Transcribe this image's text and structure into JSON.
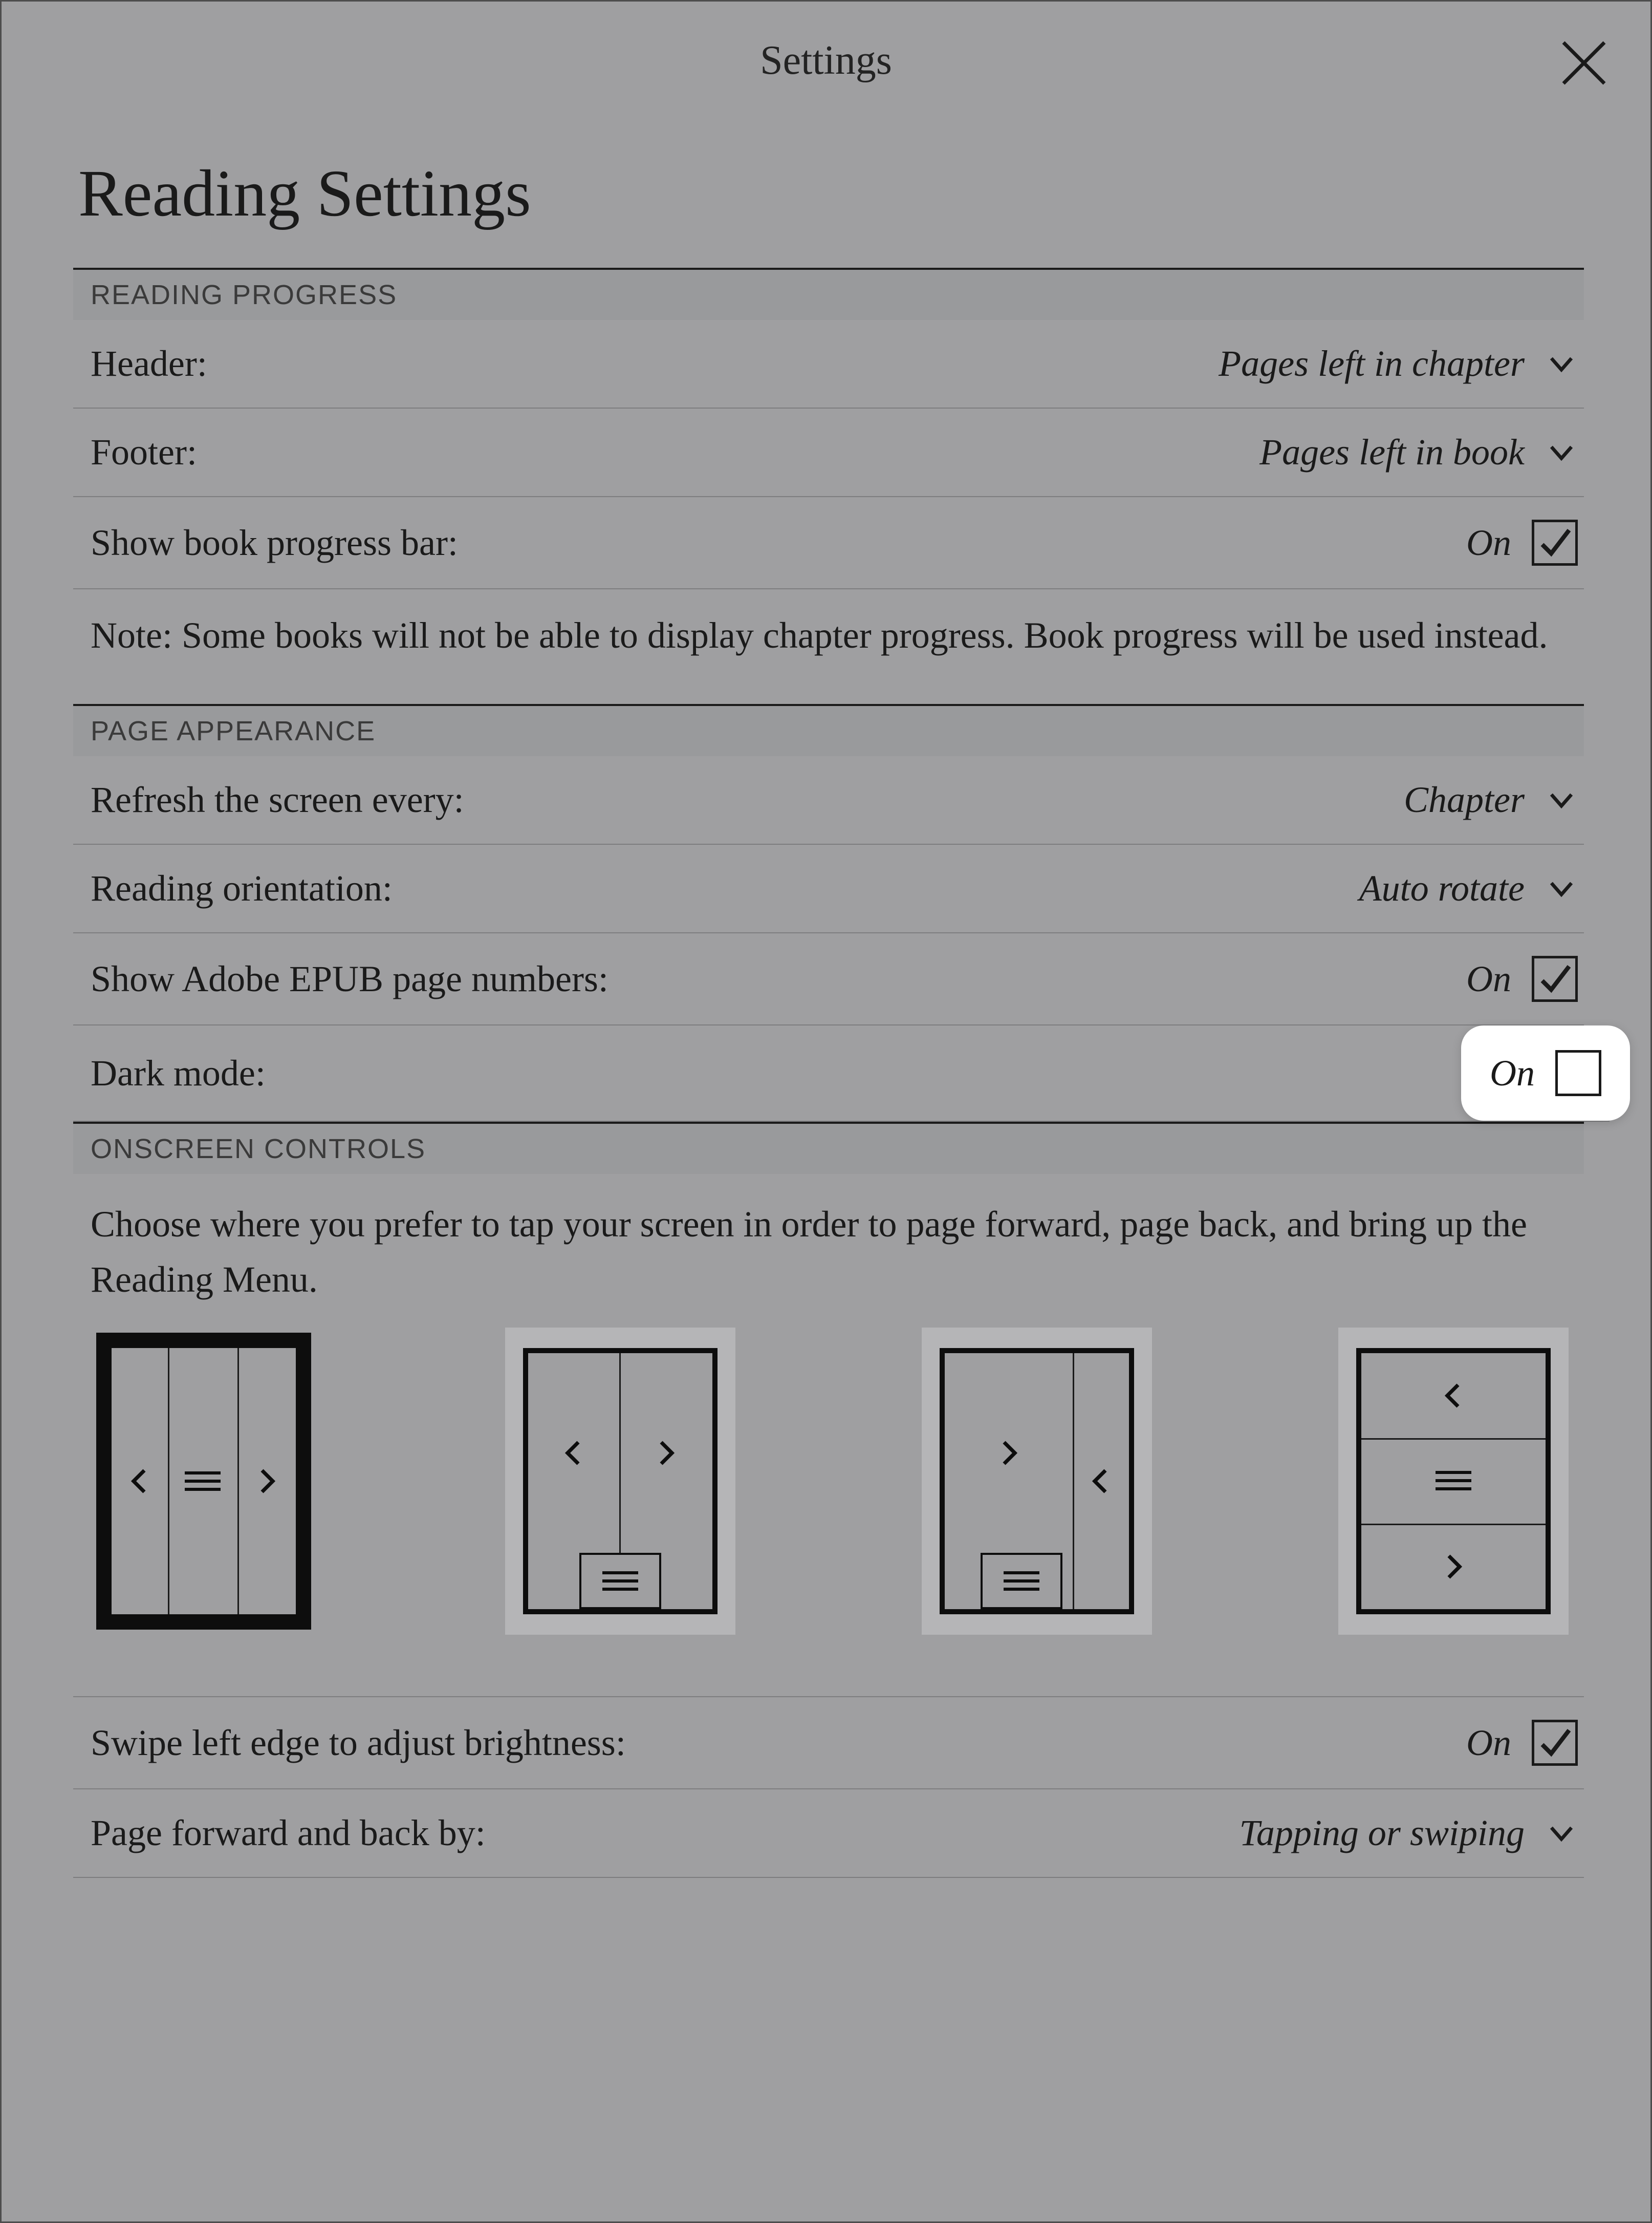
{
  "topbar": {
    "title": "Settings"
  },
  "page_title": "Reading Settings",
  "sections": {
    "reading_progress": {
      "header": "READING PROGRESS",
      "header_label": "Header:",
      "header_value": "Pages left in chapter",
      "footer_label": "Footer:",
      "footer_value": "Pages left in book",
      "show_progress_label": "Show book progress bar:",
      "show_progress_value": "On",
      "note": "Note: Some books will not be able to display chapter progress. Book progress will be used instead."
    },
    "page_appearance": {
      "header": "PAGE APPEARANCE",
      "refresh_label": "Refresh the screen every:",
      "refresh_value": "Chapter",
      "orientation_label": "Reading orientation:",
      "orientation_value": "Auto rotate",
      "adobe_label": "Show Adobe EPUB page numbers:",
      "adobe_value": "On",
      "dark_label": "Dark mode:",
      "dark_value": "On"
    },
    "onscreen_controls": {
      "header": "ONSCREEN CONTROLS",
      "intro": "Choose where you prefer to tap your screen in order to page forward, page back, and bring up the Reading Menu.",
      "swipe_label": "Swipe left edge to adjust brightness:",
      "swipe_value": "On",
      "page_method_label": "Page forward and back by:",
      "page_method_value": "Tapping or swiping"
    }
  }
}
